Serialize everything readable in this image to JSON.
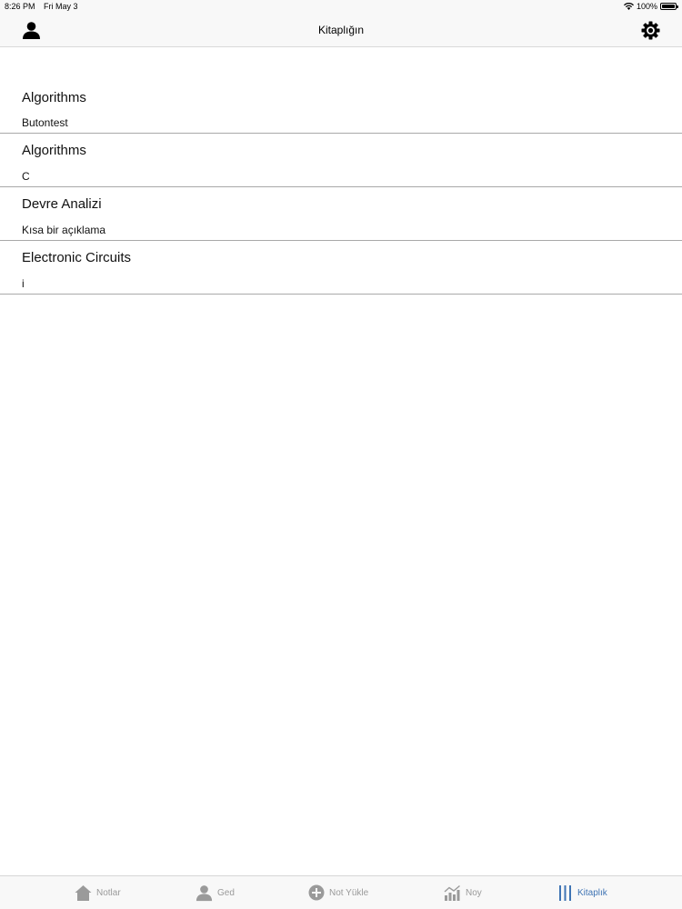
{
  "status_bar": {
    "time": "8:26 PM",
    "date": "Fri May 3",
    "battery": "100%"
  },
  "nav": {
    "title": "Kitaplığın",
    "left_icon": "person-icon",
    "right_icon": "gear-icon"
  },
  "list": {
    "items": [
      {
        "title": "Algorithms",
        "subtitle": "Butontest"
      },
      {
        "title": "Algorithms",
        "subtitle": "C"
      },
      {
        "title": "Devre Analizi",
        "subtitle": "Kısa bir açıklama"
      },
      {
        "title": "Electronic Circuits",
        "subtitle": "i"
      }
    ]
  },
  "tabs": [
    {
      "label": "Notlar",
      "icon": "house-icon"
    },
    {
      "label": "Ged",
      "icon": "person-icon"
    },
    {
      "label": "Not Yükle",
      "icon": "plus-circle-icon"
    },
    {
      "label": "Noy",
      "icon": "chart-icon"
    },
    {
      "label": "Kitaplık",
      "icon": "library-icon",
      "active": true
    }
  ],
  "colors": {
    "accent": "#3f74b4",
    "inactive": "#9a9a9a",
    "separator": "#a9a9a9",
    "bar_background": "#f8f8f8"
  }
}
